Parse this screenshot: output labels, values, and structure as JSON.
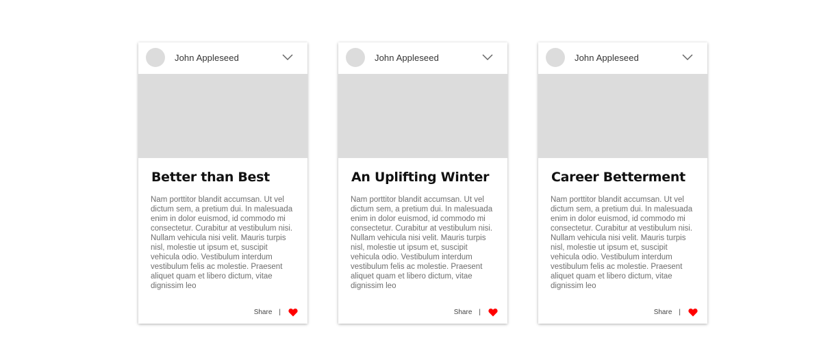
{
  "colors": {
    "placeholder": "#dcdcdc",
    "heart": "#ff0000",
    "text_body": "#6d6d6d",
    "title": "#111111"
  },
  "cards": [
    {
      "author": "John Appleseed",
      "title": "Better than Best",
      "body": "Nam porttitor blandit accumsan. Ut vel dictum sem, a pretium dui. In malesuada enim in dolor euismod, id commodo mi consectetur. Curabitur at vestibulum nisi. Nullam vehicula nisi velit. Mauris turpis nisl, molestie ut ipsum et, suscipit vehicula odio. Vestibulum interdum vestibulum felis ac molestie. Praesent aliquet quam et libero dictum, vitae dignissim leo",
      "share_label": "Share",
      "separator": "|",
      "menu_icon": "chevron-down-icon",
      "like_icon": "heart-icon"
    },
    {
      "author": "John Appleseed",
      "title": "An Uplifting Winter",
      "body": "Nam porttitor blandit accumsan. Ut vel dictum sem, a pretium dui. In malesuada enim in dolor euismod, id commodo mi consectetur. Curabitur at vestibulum nisi. Nullam vehicula nisi velit. Mauris turpis nisl, molestie ut ipsum et, suscipit vehicula odio. Vestibulum interdum vestibulum felis ac molestie. Praesent aliquet quam et libero dictum, vitae dignissim leo",
      "share_label": "Share",
      "separator": "|",
      "menu_icon": "chevron-down-icon",
      "like_icon": "heart-icon"
    },
    {
      "author": "John Appleseed",
      "title": "Career Betterment",
      "body": "Nam porttitor blandit accumsan. Ut vel dictum sem, a pretium dui. In malesuada enim in dolor euismod, id commodo mi consectetur. Curabitur at vestibulum nisi. Nullam vehicula nisi velit. Mauris turpis nisl, molestie ut ipsum et, suscipit vehicula odio. Vestibulum interdum vestibulum felis ac molestie. Praesent aliquet quam et libero dictum, vitae dignissim leo",
      "share_label": "Share",
      "separator": "|",
      "menu_icon": "chevron-down-icon",
      "like_icon": "heart-icon"
    }
  ]
}
